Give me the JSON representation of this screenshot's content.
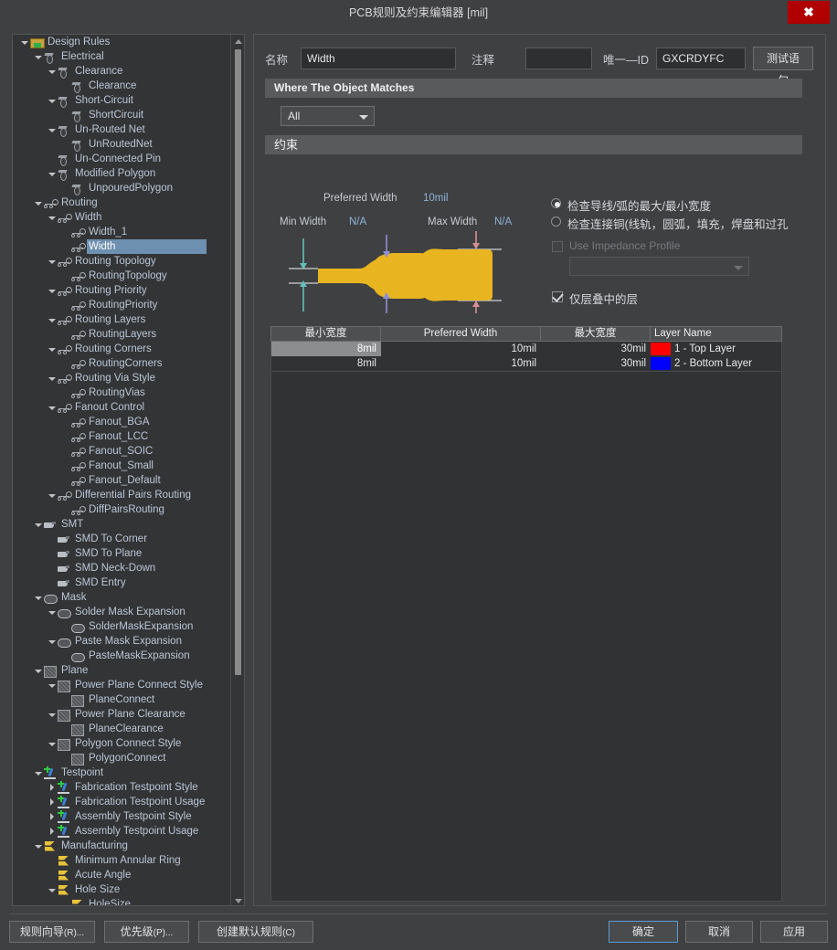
{
  "window": {
    "title": "PCB规则及约束编辑器 [mil]",
    "close_icon": "close-icon",
    "close_glyph": "✖"
  },
  "tree": {
    "items": [
      {
        "label": "Design Rules",
        "depth": 0,
        "twisty": "down",
        "icon": "folder"
      },
      {
        "label": "Electrical",
        "depth": 1,
        "twisty": "down",
        "icon": "elec"
      },
      {
        "label": "Clearance",
        "depth": 2,
        "twisty": "down",
        "icon": "elec"
      },
      {
        "label": "Clearance",
        "depth": 3,
        "twisty": "none",
        "icon": "elec"
      },
      {
        "label": "Short-Circuit",
        "depth": 2,
        "twisty": "down",
        "icon": "elec"
      },
      {
        "label": "ShortCircuit",
        "depth": 3,
        "twisty": "none",
        "icon": "elec"
      },
      {
        "label": "Un-Routed Net",
        "depth": 2,
        "twisty": "down",
        "icon": "elec"
      },
      {
        "label": "UnRoutedNet",
        "depth": 3,
        "twisty": "none",
        "icon": "elec"
      },
      {
        "label": "Un-Connected Pin",
        "depth": 2,
        "twisty": "none",
        "icon": "elec"
      },
      {
        "label": "Modified Polygon",
        "depth": 2,
        "twisty": "down",
        "icon": "elec"
      },
      {
        "label": "UnpouredPolygon",
        "depth": 3,
        "twisty": "none",
        "icon": "elec"
      },
      {
        "label": "Routing",
        "depth": 1,
        "twisty": "down",
        "icon": "route"
      },
      {
        "label": "Width",
        "depth": 2,
        "twisty": "down",
        "icon": "route"
      },
      {
        "label": "Width_1",
        "depth": 3,
        "twisty": "none",
        "icon": "route"
      },
      {
        "label": "Width",
        "depth": 3,
        "twisty": "none",
        "icon": "route",
        "selected": true
      },
      {
        "label": "Routing Topology",
        "depth": 2,
        "twisty": "down",
        "icon": "route"
      },
      {
        "label": "RoutingTopology",
        "depth": 3,
        "twisty": "none",
        "icon": "route"
      },
      {
        "label": "Routing Priority",
        "depth": 2,
        "twisty": "down",
        "icon": "route"
      },
      {
        "label": "RoutingPriority",
        "depth": 3,
        "twisty": "none",
        "icon": "route"
      },
      {
        "label": "Routing Layers",
        "depth": 2,
        "twisty": "down",
        "icon": "route"
      },
      {
        "label": "RoutingLayers",
        "depth": 3,
        "twisty": "none",
        "icon": "route"
      },
      {
        "label": "Routing Corners",
        "depth": 2,
        "twisty": "down",
        "icon": "route"
      },
      {
        "label": "RoutingCorners",
        "depth": 3,
        "twisty": "none",
        "icon": "route"
      },
      {
        "label": "Routing Via Style",
        "depth": 2,
        "twisty": "down",
        "icon": "route"
      },
      {
        "label": "RoutingVias",
        "depth": 3,
        "twisty": "none",
        "icon": "route"
      },
      {
        "label": "Fanout Control",
        "depth": 2,
        "twisty": "down",
        "icon": "route"
      },
      {
        "label": "Fanout_BGA",
        "depth": 3,
        "twisty": "none",
        "icon": "route"
      },
      {
        "label": "Fanout_LCC",
        "depth": 3,
        "twisty": "none",
        "icon": "route"
      },
      {
        "label": "Fanout_SOIC",
        "depth": 3,
        "twisty": "none",
        "icon": "route"
      },
      {
        "label": "Fanout_Small",
        "depth": 3,
        "twisty": "none",
        "icon": "route"
      },
      {
        "label": "Fanout_Default",
        "depth": 3,
        "twisty": "none",
        "icon": "route"
      },
      {
        "label": "Differential Pairs Routing",
        "depth": 2,
        "twisty": "down",
        "icon": "route"
      },
      {
        "label": "DiffPairsRouting",
        "depth": 3,
        "twisty": "none",
        "icon": "route"
      },
      {
        "label": "SMT",
        "depth": 1,
        "twisty": "down",
        "icon": "smt"
      },
      {
        "label": "SMD To Corner",
        "depth": 2,
        "twisty": "none",
        "icon": "smt"
      },
      {
        "label": "SMD To Plane",
        "depth": 2,
        "twisty": "none",
        "icon": "smt"
      },
      {
        "label": "SMD Neck-Down",
        "depth": 2,
        "twisty": "none",
        "icon": "smt"
      },
      {
        "label": "SMD Entry",
        "depth": 2,
        "twisty": "none",
        "icon": "smt"
      },
      {
        "label": "Mask",
        "depth": 1,
        "twisty": "down",
        "icon": "mask"
      },
      {
        "label": "Solder Mask Expansion",
        "depth": 2,
        "twisty": "down",
        "icon": "mask"
      },
      {
        "label": "SolderMaskExpansion",
        "depth": 3,
        "twisty": "none",
        "icon": "mask"
      },
      {
        "label": "Paste Mask Expansion",
        "depth": 2,
        "twisty": "down",
        "icon": "mask"
      },
      {
        "label": "PasteMaskExpansion",
        "depth": 3,
        "twisty": "none",
        "icon": "mask"
      },
      {
        "label": "Plane",
        "depth": 1,
        "twisty": "down",
        "icon": "plane"
      },
      {
        "label": "Power Plane Connect Style",
        "depth": 2,
        "twisty": "down",
        "icon": "plane"
      },
      {
        "label": "PlaneConnect",
        "depth": 3,
        "twisty": "none",
        "icon": "plane"
      },
      {
        "label": "Power Plane Clearance",
        "depth": 2,
        "twisty": "down",
        "icon": "plane"
      },
      {
        "label": "PlaneClearance",
        "depth": 3,
        "twisty": "none",
        "icon": "plane"
      },
      {
        "label": "Polygon Connect Style",
        "depth": 2,
        "twisty": "down",
        "icon": "plane"
      },
      {
        "label": "PolygonConnect",
        "depth": 3,
        "twisty": "none",
        "icon": "plane"
      },
      {
        "label": "Testpoint",
        "depth": 1,
        "twisty": "down",
        "icon": "tp"
      },
      {
        "label": "Fabrication Testpoint Style",
        "depth": 2,
        "twisty": "right",
        "icon": "tp"
      },
      {
        "label": "Fabrication Testpoint Usage",
        "depth": 2,
        "twisty": "right",
        "icon": "tp"
      },
      {
        "label": "Assembly Testpoint Style",
        "depth": 2,
        "twisty": "right",
        "icon": "tp"
      },
      {
        "label": "Assembly Testpoint Usage",
        "depth": 2,
        "twisty": "right",
        "icon": "tp"
      },
      {
        "label": "Manufacturing",
        "depth": 1,
        "twisty": "down",
        "icon": "mfg"
      },
      {
        "label": "Minimum Annular Ring",
        "depth": 2,
        "twisty": "none",
        "icon": "mfg"
      },
      {
        "label": "Acute Angle",
        "depth": 2,
        "twisty": "none",
        "icon": "mfg"
      },
      {
        "label": "Hole Size",
        "depth": 2,
        "twisty": "down",
        "icon": "mfg"
      },
      {
        "label": "HoleSize",
        "depth": 3,
        "twisty": "none",
        "icon": "mfg"
      }
    ]
  },
  "form": {
    "name_label": "名称",
    "name_value": "Width",
    "comment_label": "注释",
    "comment_value": "",
    "unique_id_label": "唯一—ID",
    "unique_id_value": "GXCRDYFC",
    "test_query_button": "测试语句"
  },
  "where_section": {
    "header": "Where The Object Matches",
    "scope_selected": "All"
  },
  "constraints_section": {
    "header": "约束",
    "diagram": {
      "preferred_width_label": "Preferred Width",
      "preferred_width_value": "10mil",
      "min_width_label": "Min Width",
      "min_width_value": "N/A",
      "max_width_label": "Max Width",
      "max_width_value": "N/A",
      "track_color": "#e8b521",
      "min_arrow_color": "#63bfb8",
      "pref_arrow_color": "#8d8fd6",
      "max_arrow_color": "#d68f93"
    },
    "options": {
      "radio_1": "检查导线/弧的最大/最小宽度",
      "radio_1_selected": true,
      "radio_2": "检查连接铜(线轨，圆弧，填充，焊盘和过孔",
      "radio_2_selected": false,
      "impedance_checkbox": "Use Impedance Profile",
      "impedance_checked": false,
      "impedance_profile_value": "",
      "layers_checkbox": "仅层叠中的层",
      "layers_checked": true
    },
    "table": {
      "columns": [
        "最小宽度",
        "Preferred Width",
        "最大宽度",
        "Layer Name"
      ],
      "rows": [
        {
          "min": "8mil",
          "preferred": "10mil",
          "max": "30mil",
          "layer": "1 - Top Layer",
          "color": "#ff0000",
          "selected": true
        },
        {
          "min": "8mil",
          "preferred": "10mil",
          "max": "30mil",
          "layer": "2 - Bottom Layer",
          "color": "#0000ff",
          "selected": false
        }
      ]
    }
  },
  "footer": {
    "rule_wizard": "规则向导",
    "rule_wizard_key": "(R)...",
    "priority": "优先级",
    "priority_key": "(P)...",
    "create_default": "创建默认规则",
    "create_default_key": "(C)",
    "ok": "确定",
    "cancel": "取消",
    "apply": "应用"
  }
}
